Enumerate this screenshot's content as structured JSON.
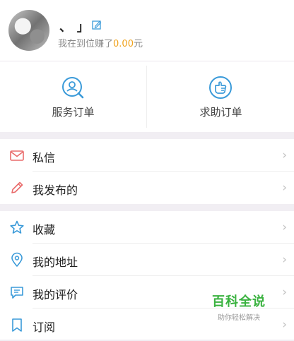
{
  "profile": {
    "name": "、 」",
    "earn_prefix": "我在到位赚了",
    "earn_amount": "0.00",
    "earn_suffix": "元"
  },
  "quick_actions": [
    {
      "label": "服务订单",
      "icon": "search-user-icon"
    },
    {
      "label": "求助订单",
      "icon": "hand-help-icon"
    }
  ],
  "menu_group_1": [
    {
      "label": "私信",
      "icon": "mail-icon"
    },
    {
      "label": "我发布的",
      "icon": "pencil-icon"
    }
  ],
  "menu_group_2": [
    {
      "label": "收藏",
      "icon": "star-icon"
    },
    {
      "label": "我的地址",
      "icon": "location-pin-icon"
    },
    {
      "label": "我的评价",
      "icon": "comment-icon"
    },
    {
      "label": "订阅",
      "icon": "bookmark-icon"
    }
  ],
  "chevron": "›",
  "watermark": {
    "title": "百科全说",
    "subtitle": "助你轻松解决"
  },
  "colors": {
    "accent": "#3a9ad9",
    "amount": "#f0a21b",
    "watermark": "#39b23f",
    "icon_red": "#e96b6b"
  }
}
